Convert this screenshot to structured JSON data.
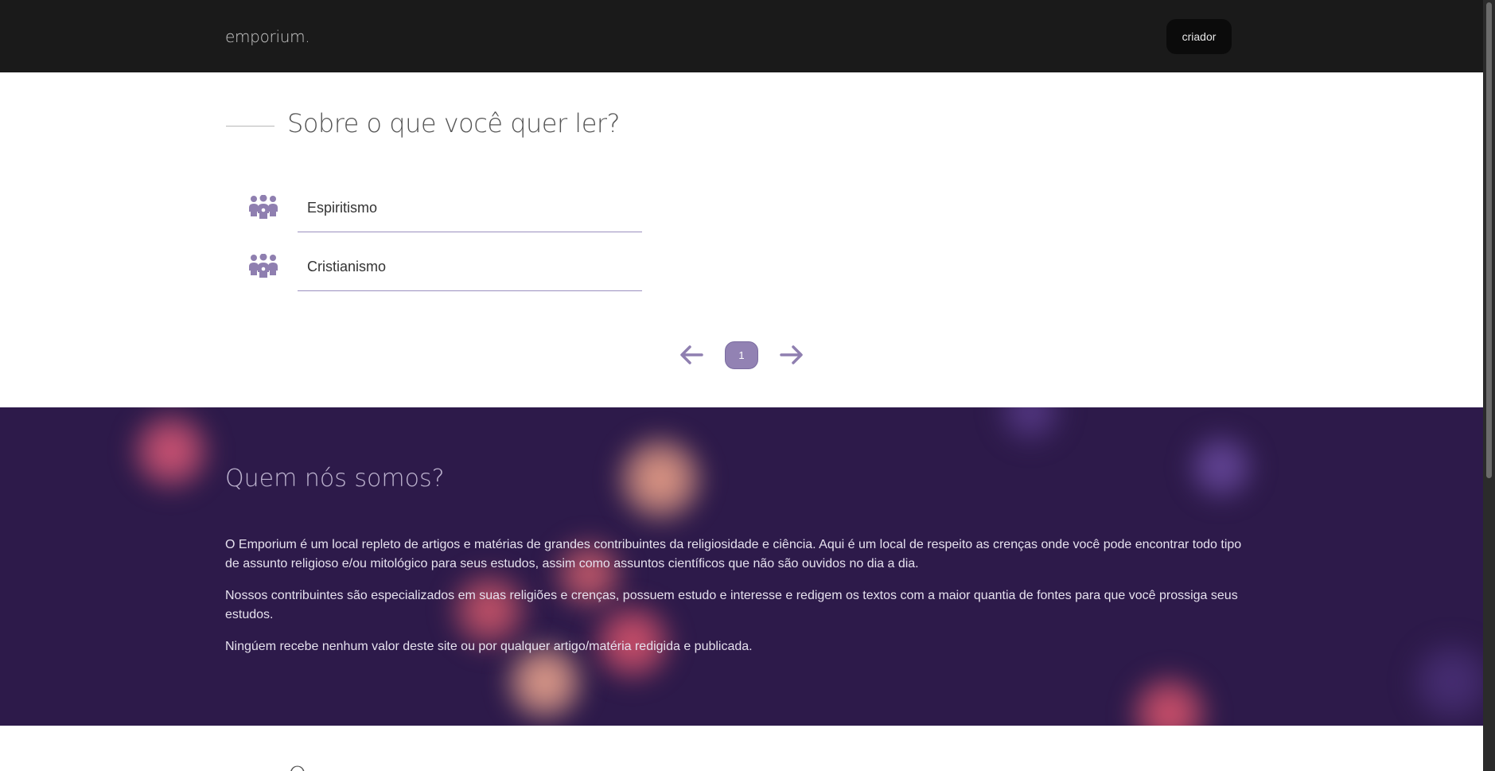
{
  "nav": {
    "brand": "emporium.",
    "button": "criador"
  },
  "topics": {
    "heading": "Sobre o que você quer ler?",
    "items": [
      {
        "label": "Espiritismo",
        "icon": "people-group-icon"
      },
      {
        "label": "Cristianismo",
        "icon": "people-group-icon"
      }
    ]
  },
  "pagination": {
    "current_page": "1",
    "prev_icon": "arrow-left-icon",
    "next_icon": "arrow-right-icon"
  },
  "about": {
    "title": "Quem nós somos?",
    "paragraphs": [
      "O Emporium é um local repleto de artigos e matérias de grandes contribuintes da religiosidade e ciência. Aqui é um local de respeito as crenças onde você pode encontrar todo tipo de assunto religioso e/ou mitológico para seus estudos, assim como assuntos científicos que não são ouvidos no dia a dia.",
      "Nossos contribuintes são especializados em suas religiões e crenças, possuem estudo e interesse e redigem os textos com a maior quantia de fontes para que você prossiga seus estudos.",
      "Ningúem recebe nenhum valor deste site ou por qualquer artigo/matéria redigida e publicada."
    ]
  },
  "colors": {
    "navbar": "#1a1a1a",
    "accent": "#9282b3",
    "about_background": "#2d1a4a"
  }
}
